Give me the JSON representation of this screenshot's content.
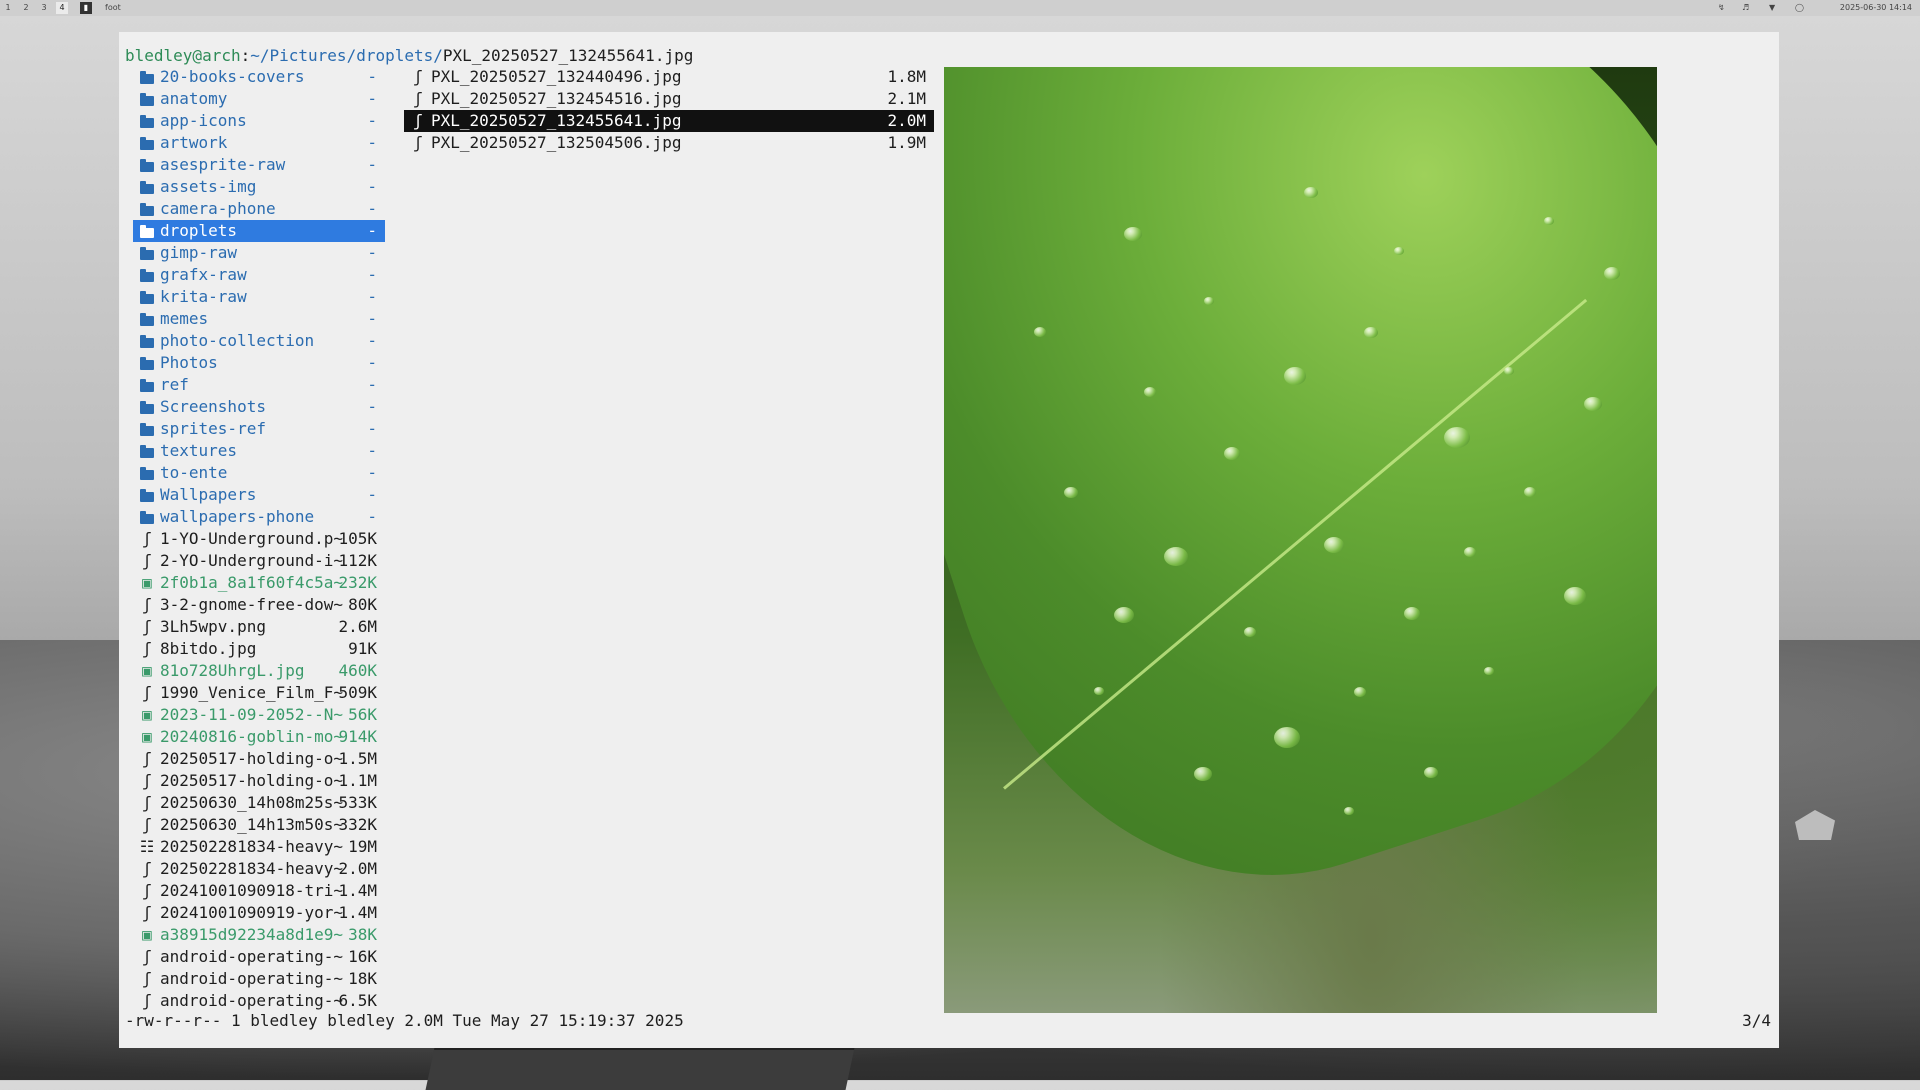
{
  "topbar": {
    "workspaces": [
      "1",
      "2",
      "3",
      "4"
    ],
    "active_workspace": "4",
    "window_title": "foot",
    "clock": "2025-06-30 14:14",
    "tray_icons": [
      "link-icon",
      "volume-icon",
      "wifi-icon",
      "power-icon"
    ]
  },
  "prompt": {
    "user_host": "bledley@arch",
    "sep": ":",
    "path": "~/Pictures/droplets/",
    "file": "PXL_20250527_132455641.jpg"
  },
  "parent_column": [
    {
      "type": "dir",
      "name": "20-books-covers",
      "size": "-"
    },
    {
      "type": "dir",
      "name": "anatomy",
      "size": "-"
    },
    {
      "type": "dir",
      "name": "app-icons",
      "size": "-"
    },
    {
      "type": "dir",
      "name": "artwork",
      "size": "-"
    },
    {
      "type": "dir",
      "name": "asesprite-raw",
      "size": "-"
    },
    {
      "type": "dir",
      "name": "assets-img",
      "size": "-"
    },
    {
      "type": "dir",
      "name": "camera-phone",
      "size": "-"
    },
    {
      "type": "dir",
      "name": "droplets",
      "size": "-",
      "selected": true
    },
    {
      "type": "dir",
      "name": "gimp-raw",
      "size": "-"
    },
    {
      "type": "dir",
      "name": "grafx-raw",
      "size": "-"
    },
    {
      "type": "dir",
      "name": "krita-raw",
      "size": "-"
    },
    {
      "type": "dir",
      "name": "memes",
      "size": "-"
    },
    {
      "type": "dir",
      "name": "photo-collection",
      "size": "-"
    },
    {
      "type": "dir",
      "name": "Photos",
      "size": "-"
    },
    {
      "type": "dir",
      "name": "ref",
      "size": "-"
    },
    {
      "type": "dir",
      "name": "Screenshots",
      "size": "-"
    },
    {
      "type": "dir",
      "name": "sprites-ref",
      "size": "-"
    },
    {
      "type": "dir",
      "name": "textures",
      "size": "-"
    },
    {
      "type": "dir",
      "name": "to-ente",
      "size": "-"
    },
    {
      "type": "dir",
      "name": "Wallpapers",
      "size": "-"
    },
    {
      "type": "dir",
      "name": "wallpapers-phone",
      "size": "-"
    },
    {
      "type": "file",
      "name": "1-YO-Underground.p~",
      "size": "105K"
    },
    {
      "type": "file",
      "name": "2-YO-Underground-i~",
      "size": "112K"
    },
    {
      "type": "img",
      "name": "2f0b1a_8a1f60f4c5a~",
      "size": "232K"
    },
    {
      "type": "file",
      "name": "3-2-gnome-free-dow~",
      "size": "80K"
    },
    {
      "type": "file",
      "name": "3Lh5wpv.png",
      "size": "2.6M"
    },
    {
      "type": "file",
      "name": "8bitdo.jpg",
      "size": "91K"
    },
    {
      "type": "img",
      "name": "81o728UhrgL.jpg",
      "size": "460K"
    },
    {
      "type": "file",
      "name": "1990_Venice_Film_F~",
      "size": "509K"
    },
    {
      "type": "img",
      "name": "2023-11-09-2052--N~",
      "size": "56K"
    },
    {
      "type": "img",
      "name": "20240816-goblin-mo~",
      "size": "914K"
    },
    {
      "type": "file",
      "name": "20250517-holding-o~",
      "size": "1.5M"
    },
    {
      "type": "file",
      "name": "20250517-holding-o~",
      "size": "1.1M"
    },
    {
      "type": "file",
      "name": "20250630_14h08m25s~",
      "size": "533K"
    },
    {
      "type": "file",
      "name": "20250630_14h13m50s~",
      "size": "332K"
    },
    {
      "type": "doc",
      "name": "202502281834-heavy~",
      "size": "19M"
    },
    {
      "type": "file",
      "name": "202502281834-heavy~",
      "size": "2.0M"
    },
    {
      "type": "file",
      "name": "20241001090918-tri~",
      "size": "1.4M"
    },
    {
      "type": "file",
      "name": "20241001090919-yor~",
      "size": "1.4M"
    },
    {
      "type": "img",
      "name": "a38915d92234a8d1e9~",
      "size": "38K"
    },
    {
      "type": "file",
      "name": "android-operating-~",
      "size": "16K"
    },
    {
      "type": "file",
      "name": "android-operating-~",
      "size": "18K"
    },
    {
      "type": "file",
      "name": "android-operating-~",
      "size": "6.5K"
    }
  ],
  "current_column": [
    {
      "type": "file",
      "name": "PXL_20250527_132440496.jpg",
      "size": "1.8M"
    },
    {
      "type": "file",
      "name": "PXL_20250527_132454516.jpg",
      "size": "2.1M"
    },
    {
      "type": "file",
      "name": "PXL_20250527_132455641.jpg",
      "size": "2.0M",
      "selected": true
    },
    {
      "type": "file",
      "name": "PXL_20250527_132504506.jpg",
      "size": "1.9M"
    }
  ],
  "statusbar": {
    "info": "-rw-r--r-- 1 bledley bledley 2.0M Tue May 27 15:19:37 2025",
    "position": "3/4"
  },
  "preview": {
    "subject": "green leaf with water droplets",
    "colors": {
      "leaf_light": "#9ed15a",
      "leaf_dark": "#3d7522",
      "background": "#2c5218"
    }
  }
}
